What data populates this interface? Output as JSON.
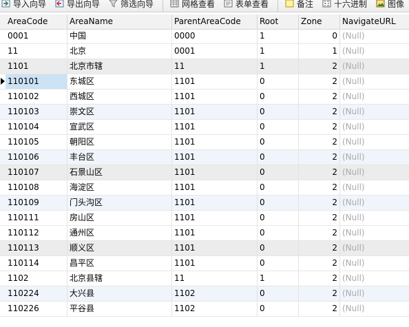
{
  "toolbar": {
    "items": [
      {
        "label": "导入向导",
        "icon": "import-wizard-icon"
      },
      {
        "label": "导出向导",
        "icon": "export-wizard-icon"
      },
      {
        "label": "筛选向导",
        "icon": "filter-wizard-icon"
      },
      {
        "label": "网格查看",
        "icon": "grid-view-icon"
      },
      {
        "label": "表单查看",
        "icon": "form-view-icon"
      },
      {
        "label": "备注",
        "icon": "memo-icon"
      },
      {
        "label": "十六进制",
        "icon": "hex-icon"
      },
      {
        "label": "图像",
        "icon": "image-icon"
      }
    ]
  },
  "grid": {
    "columns": [
      "AreaCode",
      "AreaName",
      "ParentAreaCode",
      "Root",
      "Zone",
      "NavigateURL"
    ],
    "rows": [
      [
        "0001",
        "中国",
        "0000",
        "1",
        "0",
        "(Null)"
      ],
      [
        "11",
        "北京",
        "0001",
        "1",
        "1",
        "(Null)"
      ],
      [
        "1101",
        "北京市辖",
        "11",
        "1",
        "2",
        "(Null)"
      ],
      [
        "110101",
        "东城区",
        "1101",
        "0",
        "2",
        "(Null)"
      ],
      [
        "110102",
        "西城区",
        "1101",
        "0",
        "2",
        "(Null)"
      ],
      [
        "110103",
        "崇文区",
        "1101",
        "0",
        "2",
        "(Null)"
      ],
      [
        "110104",
        "宣武区",
        "1101",
        "0",
        "2",
        "(Null)"
      ],
      [
        "110105",
        "朝阳区",
        "1101",
        "0",
        "2",
        "(Null)"
      ],
      [
        "110106",
        "丰台区",
        "1101",
        "0",
        "2",
        "(Null)"
      ],
      [
        "110107",
        "石景山区",
        "1101",
        "0",
        "2",
        "(Null)"
      ],
      [
        "110108",
        "海淀区",
        "1101",
        "0",
        "2",
        "(Null)"
      ],
      [
        "110109",
        "门头沟区",
        "1101",
        "0",
        "2",
        "(Null)"
      ],
      [
        "110111",
        "房山区",
        "1101",
        "0",
        "2",
        "(Null)"
      ],
      [
        "110112",
        "通州区",
        "1101",
        "0",
        "2",
        "(Null)"
      ],
      [
        "110113",
        "顺义区",
        "1101",
        "0",
        "2",
        "(Null)"
      ],
      [
        "110114",
        "昌平区",
        "1101",
        "0",
        "2",
        "(Null)"
      ],
      [
        "1102",
        "北京县辖",
        "11",
        "1",
        "2",
        "(Null)"
      ],
      [
        "110224",
        "大兴县",
        "1102",
        "0",
        "2",
        "(Null)"
      ],
      [
        "110226",
        "平谷县",
        "1102",
        "0",
        "2",
        "(Null)"
      ]
    ],
    "current_row": 3
  }
}
